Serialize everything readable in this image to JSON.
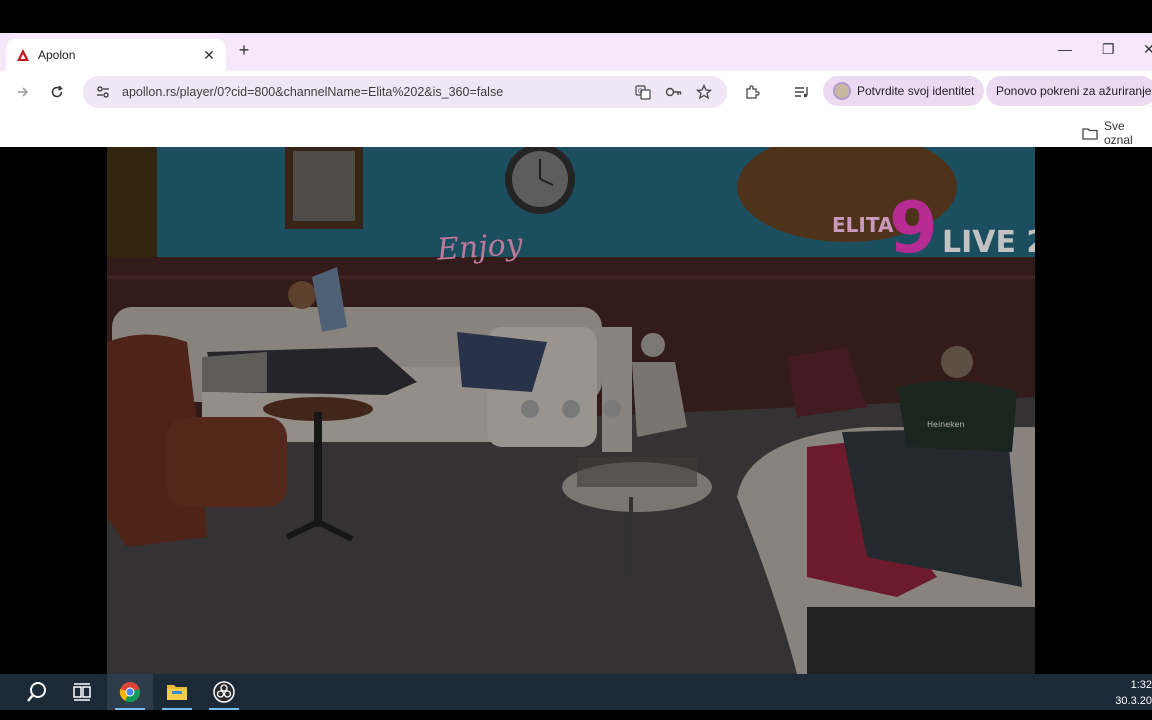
{
  "browser": {
    "tab_title": "Apolon",
    "tab_close": "✕",
    "new_tab": "+",
    "minimize": "—",
    "restore": "❐",
    "close": "✕",
    "url": "apollon.rs/player/0?cid=800&channelName=Elita%202&is_360=false",
    "verify_identity_label": "Potvrdite svoj identitet",
    "relaunch_update_label": "Ponovo pokreni za ažuriranje",
    "bookmarks_folder_label": "Sve oznal"
  },
  "video": {
    "logo_text": "ELITA",
    "logo_number": "9",
    "live_label": "LIVE 2",
    "neon_sign": "Enjoy",
    "shirt_text": "Heineken",
    "loading_dots": 3
  },
  "taskbar": {
    "time": "1:32",
    "date": "30.3.20"
  },
  "colors": {
    "tabstrip_bg": "#f6e7fb",
    "omnibox_bg": "#f1e6f6",
    "pill_bg": "#ecdaf3",
    "taskbar_bg": "#1c2a38",
    "wall_teal": "#1f5a6e"
  },
  "icons": [
    "apolon-favicon",
    "forward-icon",
    "reload-icon",
    "site-info-icon",
    "translate-icon",
    "password-key-icon",
    "bookmark-star-icon",
    "extensions-icon",
    "media-queue-icon",
    "profile-avatar-icon",
    "folder-icon",
    "search-icon",
    "task-view-icon",
    "chrome-icon",
    "file-explorer-icon",
    "obs-icon"
  ]
}
